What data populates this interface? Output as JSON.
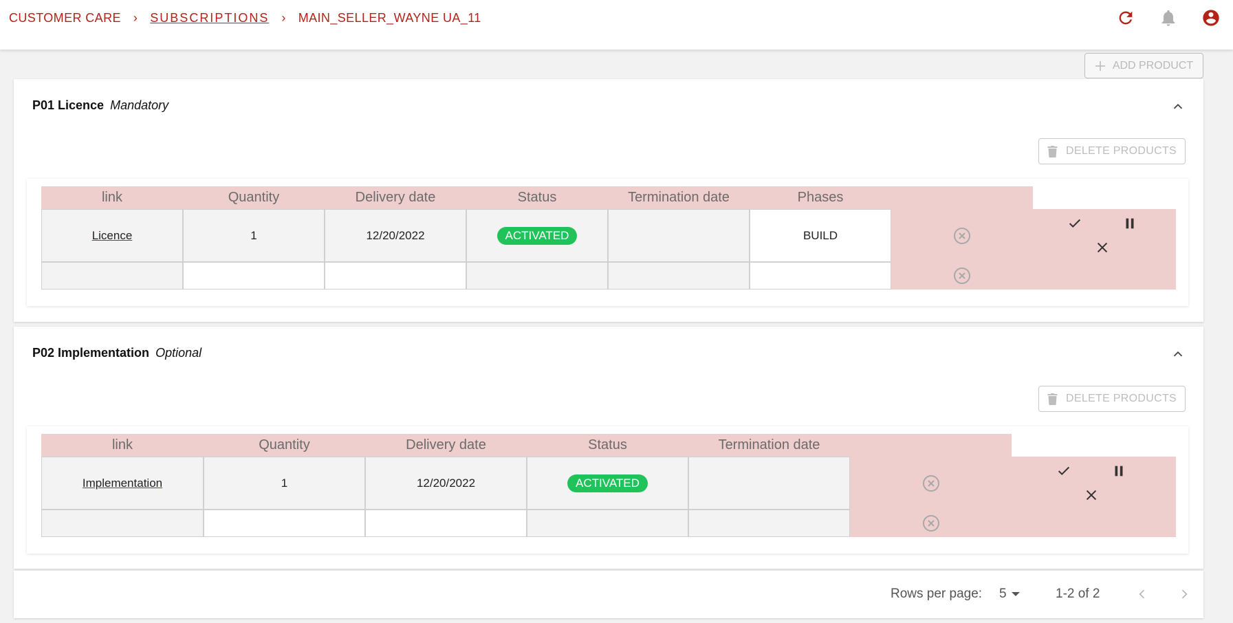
{
  "header": {
    "breadcrumb": [
      "CUSTOMER CARE",
      "SUBSCRIPTIONS",
      "MAIN_SELLER_WAYNE UA_11"
    ],
    "icons": [
      "refresh-icon",
      "bell-icon",
      "account-icon"
    ]
  },
  "toolbar": {
    "add_product_label": "ADD PRODUCT"
  },
  "products": [
    {
      "code": "P01 Licence",
      "requirement": "Mandatory",
      "delete_label": "DELETE PRODUCTS",
      "columns": [
        "link",
        "Quantity",
        "Delivery date",
        "Status",
        "Termination date",
        "Phases"
      ],
      "row": {
        "link": "Licence",
        "quantity": "1",
        "delivery_date": "12/20/2022",
        "status": "ACTIVATED",
        "termination_date": "",
        "phase": "BUILD"
      }
    },
    {
      "code": "P02 Implementation",
      "requirement": "Optional",
      "delete_label": "DELETE PRODUCTS",
      "columns": [
        "link",
        "Quantity",
        "Delivery date",
        "Status",
        "Termination date"
      ],
      "row": {
        "link": "Implementation",
        "quantity": "1",
        "delivery_date": "12/20/2022",
        "status": "ACTIVATED",
        "termination_date": ""
      }
    }
  ],
  "pagination": {
    "rows_per_page_label": "Rows per page:",
    "rows_per_page": "5",
    "range": "1-2 of 2"
  },
  "colors": {
    "brand": "#b42318",
    "header_cell": "#efcfcd",
    "status_active": "#1fc35a"
  }
}
